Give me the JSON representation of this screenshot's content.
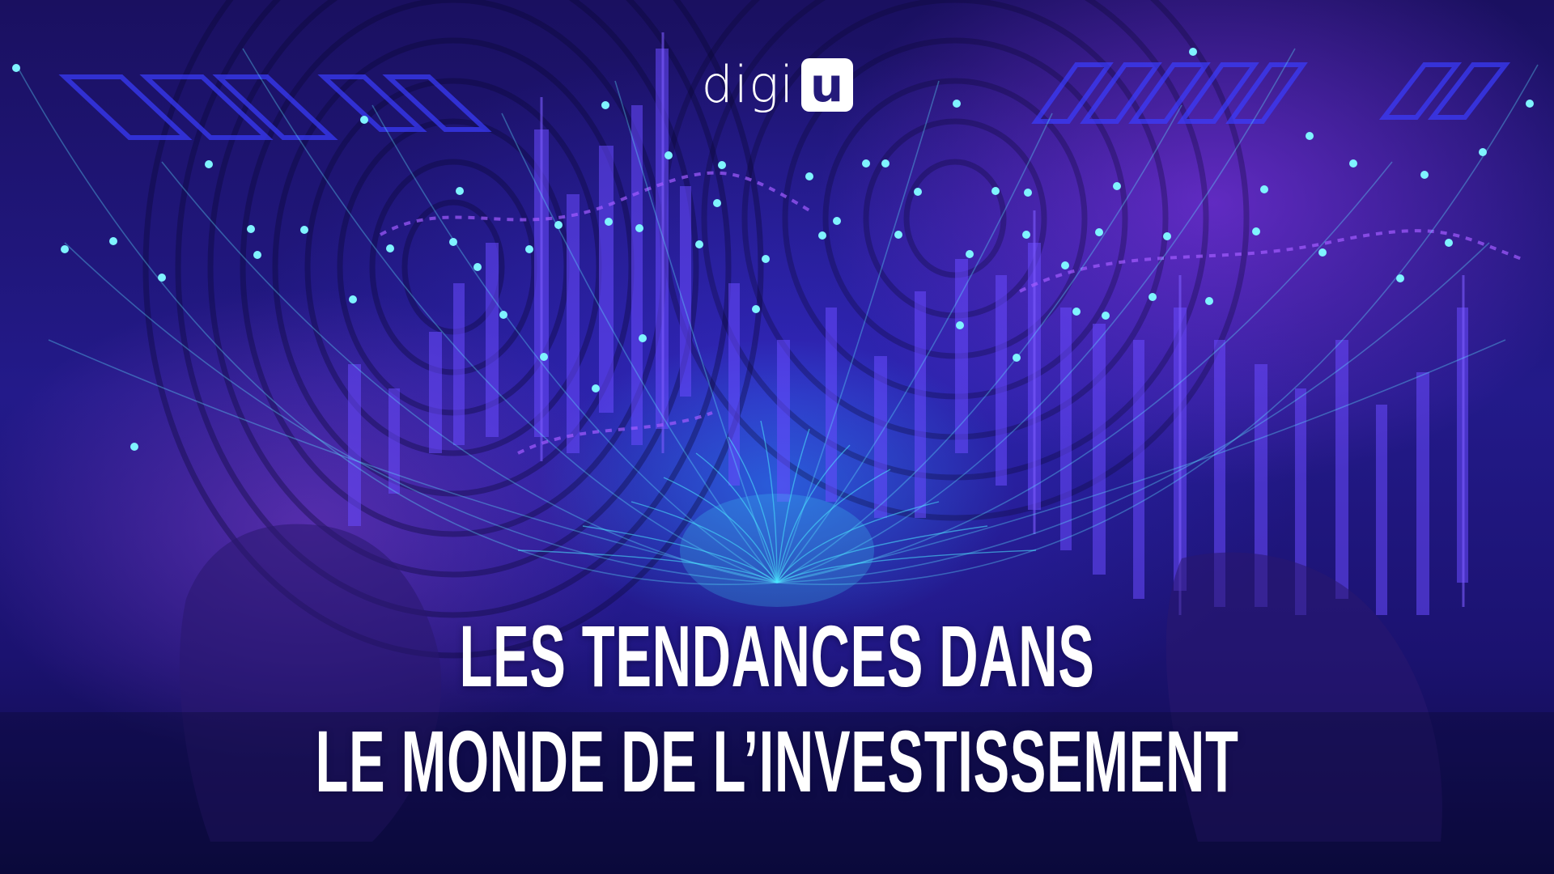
{
  "logo": {
    "word": "digi",
    "box_letter": "u"
  },
  "headline": {
    "line1": "LES TENDANCES DANS",
    "line2": "LE MONDE DE L’INVESTISSEMENT"
  },
  "colors": {
    "background_dark": "#0d0a3a",
    "accent_cyan": "#4de9ff",
    "accent_violet": "#8a3cff",
    "text": "#ffffff"
  }
}
